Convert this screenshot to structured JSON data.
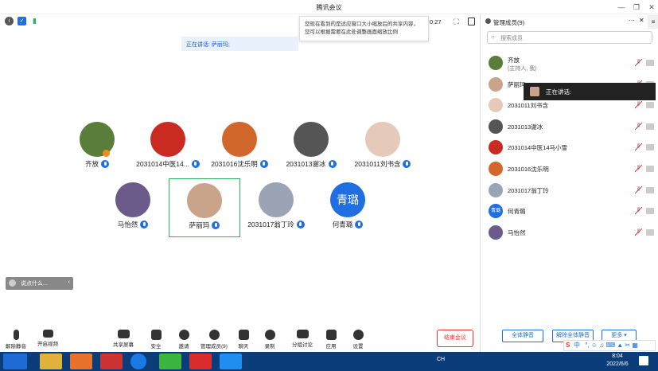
{
  "window": {
    "title": "腾讯会议"
  },
  "topbar": {
    "timer": "0:27"
  },
  "tooltip": {
    "text": "您现在看到的是适应窗口大小缩放后的共享内容，您可以根据需要在此处调整画面缩放比例"
  },
  "speaking_banner": {
    "label": "正在讲话: 萨丽玛;"
  },
  "participants": [
    {
      "name": "齐放",
      "mic": true,
      "host": true,
      "color": "#5a7d3a"
    },
    {
      "name": "2031014中医14...",
      "mic": true,
      "color": "#c92a22"
    },
    {
      "name": "2031016沈乐明",
      "mic": true,
      "color": "#d2672b"
    },
    {
      "name": "2031013谢冰",
      "mic": true,
      "color": "#555555"
    },
    {
      "name": "2031011刘书含",
      "mic": true,
      "color": "#e5c9b9"
    },
    {
      "name": "马怡然",
      "mic": true,
      "color": "#6b5b8a"
    },
    {
      "name": "萨丽玛",
      "mic": true,
      "active": true,
      "color": "#caa48a"
    },
    {
      "name": "2031017翁丁玲",
      "mic": true,
      "color": "#9aa4b5"
    },
    {
      "name": "何青璐",
      "mic": true,
      "initials": "青璐",
      "color": "#1f6fe0"
    }
  ],
  "say_box": {
    "placeholder": "说点什么..."
  },
  "bottom_toolbar": {
    "mute": "解除静音",
    "video": "开启视频",
    "share": "共享屏幕",
    "security": "安全",
    "invite": "邀请",
    "members": "管理成员(9)",
    "chat": "聊天",
    "record": "录制",
    "breakout": "分组讨论",
    "apps": "应用",
    "settings": "设置",
    "end": "结束会议"
  },
  "member_panel": {
    "title": "管理成员(9)",
    "search_placeholder": "搜索成员",
    "speaking_popup": "正在讲话:",
    "members": [
      {
        "name": "齐放",
        "sub": "(主持人, 我)",
        "color": "#5a7d3a"
      },
      {
        "name": "萨丽玛",
        "color": "#caa48a"
      },
      {
        "name": "2031011刘书含",
        "color": "#e5c9b9"
      },
      {
        "name": "2031013谢冰",
        "color": "#555555"
      },
      {
        "name": "2031014中医14马小雪",
        "color": "#c92a22"
      },
      {
        "name": "2031016沈乐明",
        "color": "#d2672b"
      },
      {
        "name": "2031017翁丁玲",
        "color": "#9aa4b5"
      },
      {
        "name": "何青璐",
        "initials": "青璐",
        "color": "#1f6fe0"
      },
      {
        "name": "马怡然",
        "color": "#6b5b8a"
      }
    ],
    "buttons": {
      "mute_all": "全体静音",
      "unmute_all": "解除全体静音",
      "more": "更多 ▾"
    }
  },
  "taskbar": {
    "lang": "CH",
    "time": "8:04",
    "date": "2022/6/6",
    "ime": "中"
  },
  "colors": {
    "accent": "#1f6fe0",
    "danger": "#e33333",
    "active_border": "#2cb164"
  }
}
